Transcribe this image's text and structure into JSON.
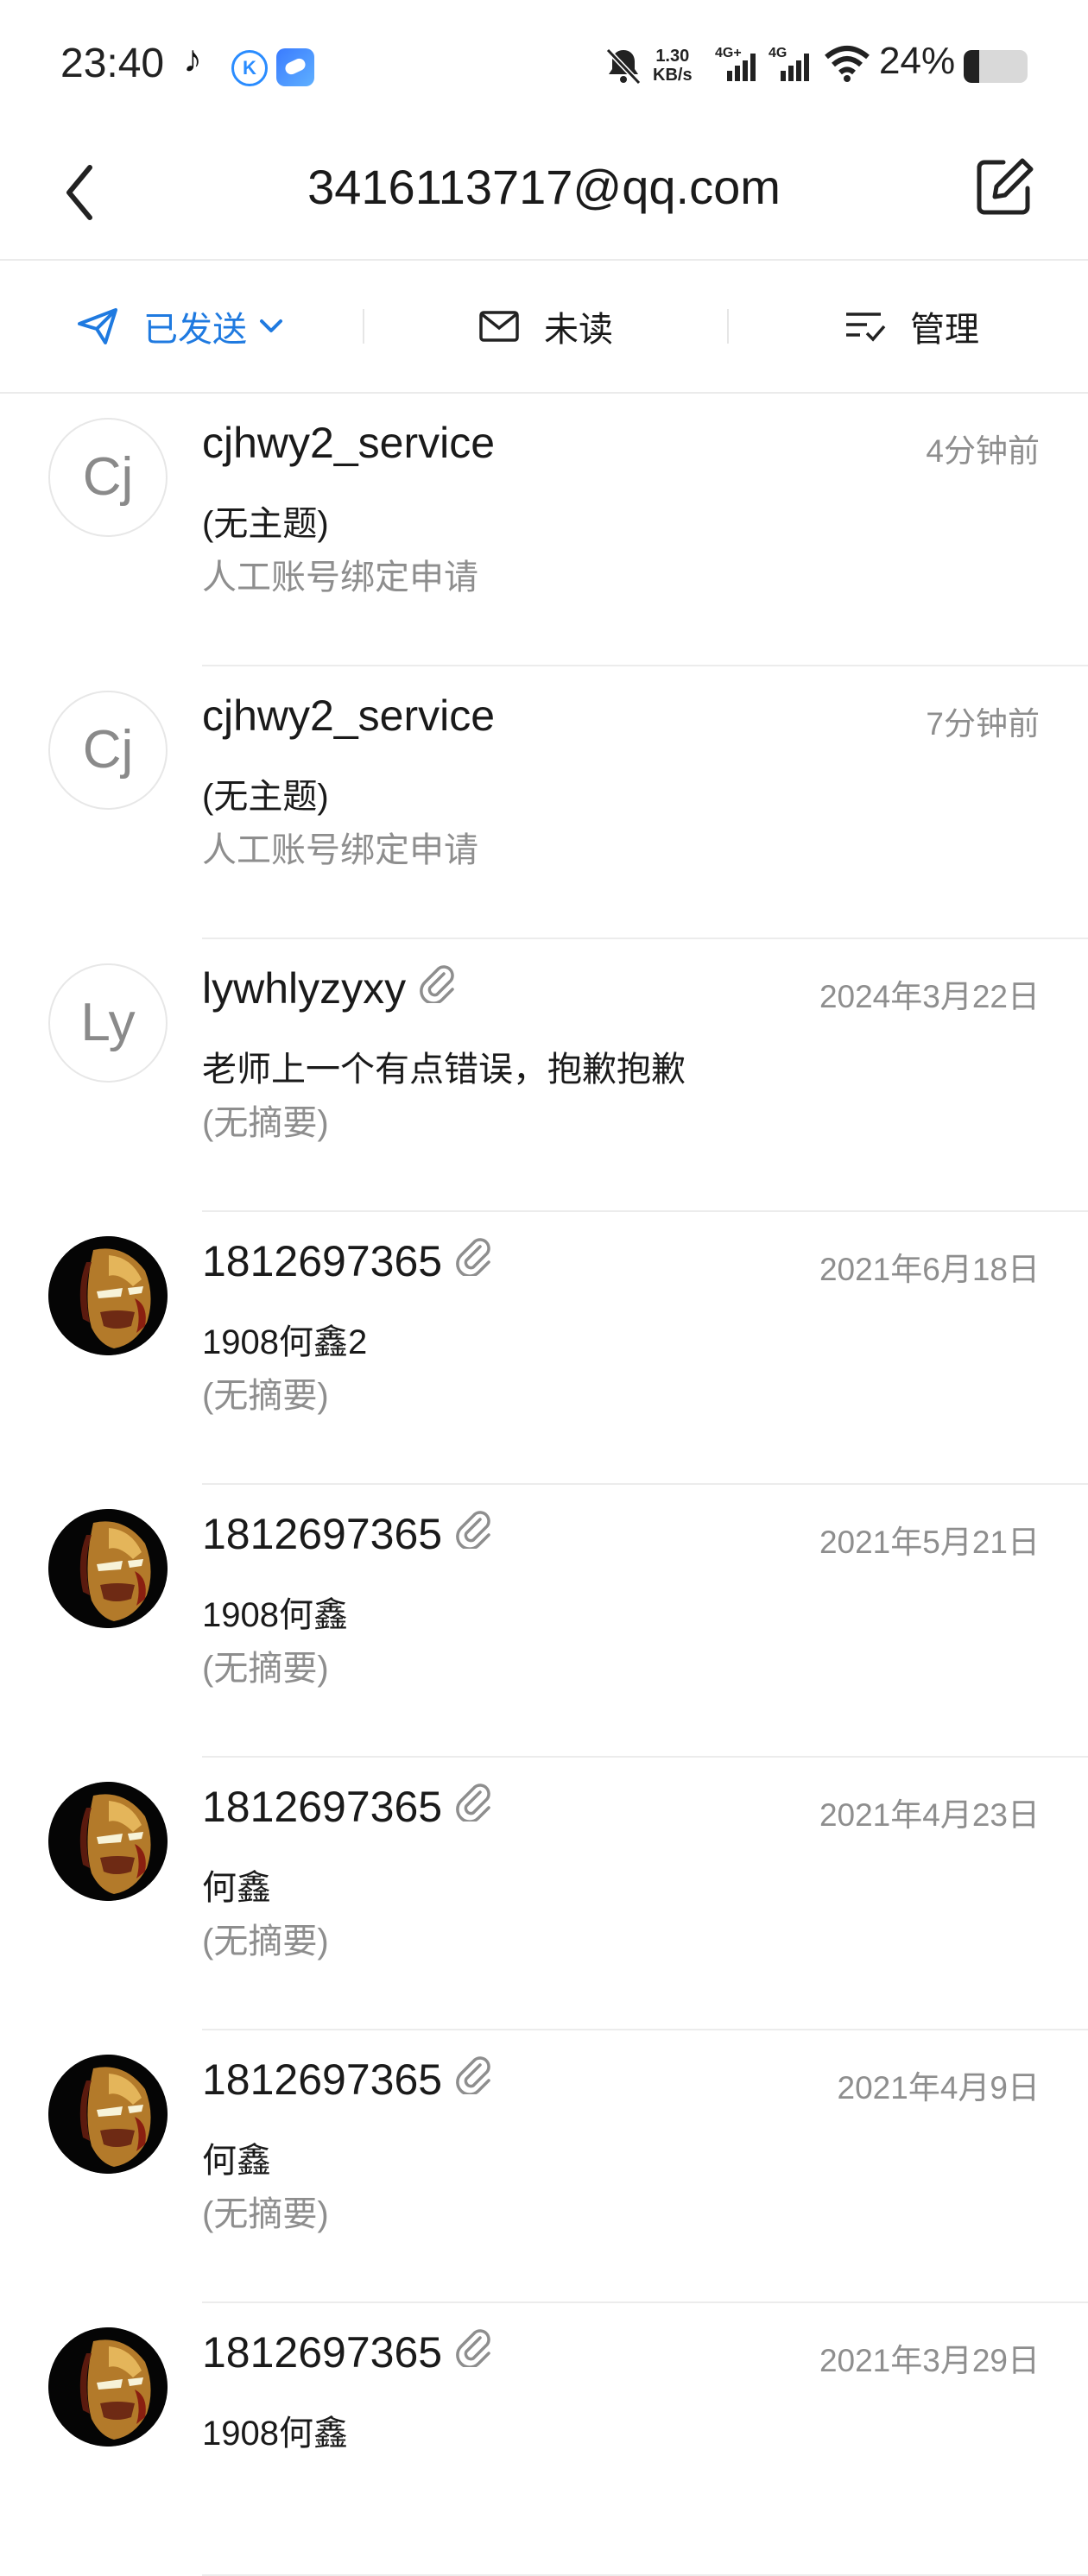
{
  "status_bar": {
    "time": "23:40",
    "net_speed_value": "1.30",
    "net_speed_unit": "KB/s",
    "signal1_label": "4G+",
    "signal2_label": "4G",
    "battery_text": "24%",
    "battery_level_percent": 24
  },
  "header": {
    "title": "3416113717@qq.com",
    "back_icon": "chevron-left-icon",
    "compose_icon": "compose-icon"
  },
  "tabs": {
    "sent_label": "已发送",
    "unread_label": "未读",
    "manage_label": "管理"
  },
  "colors": {
    "accent": "#1f7ae0",
    "secondary_text": "#8e8e8e",
    "divider": "#ececec"
  },
  "mails": [
    {
      "avatar_text": "Cj",
      "avatar_type": "letter",
      "sender": "cjhwy2_service",
      "attachment": false,
      "date": "4分钟前",
      "subject": "(无主题)",
      "summary": "人工账号绑定申请"
    },
    {
      "avatar_text": "Cj",
      "avatar_type": "letter",
      "sender": "cjhwy2_service",
      "attachment": false,
      "date": "7分钟前",
      "subject": "(无主题)",
      "summary": "人工账号绑定申请"
    },
    {
      "avatar_text": "Ly",
      "avatar_type": "letter",
      "sender": "lywhlyzyxy",
      "attachment": true,
      "date": "2024年3月22日",
      "subject": "老师上一个有点错误，抱歉抱歉",
      "summary": "(无摘要)"
    },
    {
      "avatar_text": "",
      "avatar_type": "ironman-image",
      "sender": "1812697365",
      "attachment": true,
      "date": "2021年6月18日",
      "subject": "1908何鑫2",
      "summary": "(无摘要)"
    },
    {
      "avatar_text": "",
      "avatar_type": "ironman-image",
      "sender": "1812697365",
      "attachment": true,
      "date": "2021年5月21日",
      "subject": "1908何鑫",
      "summary": "(无摘要)"
    },
    {
      "avatar_text": "",
      "avatar_type": "ironman-image",
      "sender": "1812697365",
      "attachment": true,
      "date": "2021年4月23日",
      "subject": "何鑫",
      "summary": "(无摘要)"
    },
    {
      "avatar_text": "",
      "avatar_type": "ironman-image",
      "sender": "1812697365",
      "attachment": true,
      "date": "2021年4月9日",
      "subject": "何鑫",
      "summary": "(无摘要)"
    },
    {
      "avatar_text": "",
      "avatar_type": "ironman-image",
      "sender": "1812697365",
      "attachment": true,
      "date": "2021年3月29日",
      "subject": "1908何鑫",
      "summary": ""
    }
  ]
}
